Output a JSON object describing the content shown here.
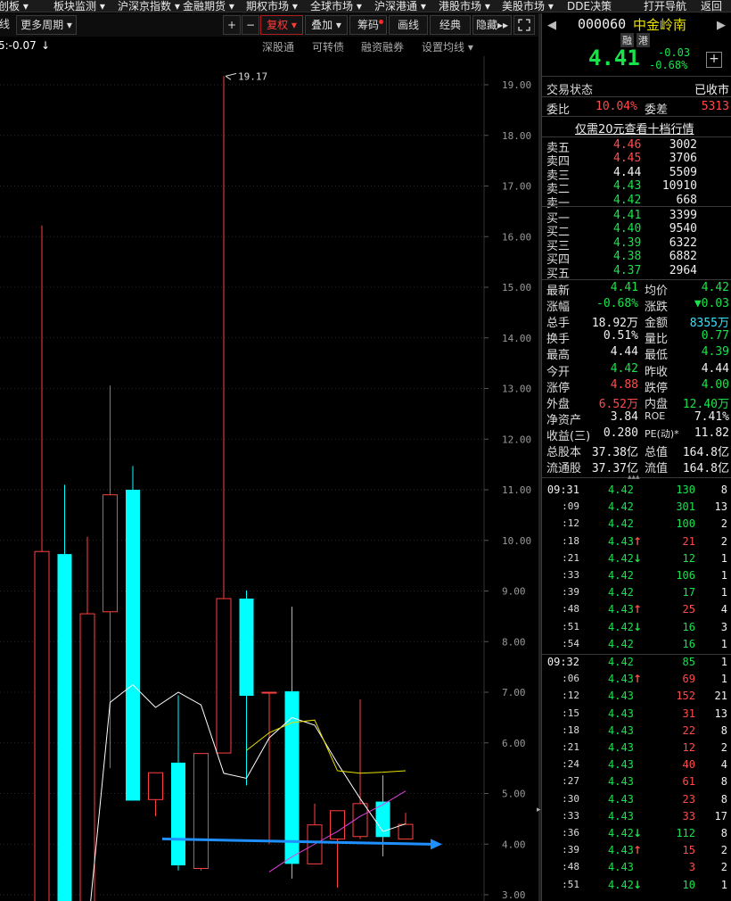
{
  "menu": [
    "创板",
    "板块监测",
    "沪深京指数",
    "金融期货",
    "期权市场",
    "全球市场",
    "沪深港通",
    "港股市场",
    "美股市场",
    "DDE决策",
    "打开导航",
    "返回"
  ],
  "toolbar": {
    "left_label": "线",
    "period": "更多周期",
    "plus": "+",
    "minus": "−",
    "fuquan": "复权",
    "diejia": "叠加",
    "chouma": "筹码",
    "huaxian": "画线",
    "jingdian": "经典",
    "yincang": "隐藏",
    "expand_icon": "expand-icon"
  },
  "subbar": {
    "ma_info": "5:-0.07",
    "arrow": "↓",
    "items": [
      "深股通",
      "可转债",
      "融资融券",
      "设置均线"
    ]
  },
  "chart_data": {
    "type": "candlestick",
    "ylim": [
      3.0,
      20.0
    ],
    "yticks": [
      "19.00",
      "18.00",
      "17.00",
      "16.00",
      "15.00",
      "14.00",
      "13.00",
      "12.00",
      "11.00",
      "10.00",
      "9.00",
      "8.00",
      "7.00",
      "6.00",
      "5.00",
      "4.00",
      "3.00"
    ],
    "annotation_high": "19.17",
    "colors": {
      "up": "#ff4040",
      "down": "#00ffff",
      "ma5": "#ffffff",
      "ma10": "#e8e000",
      "ma20": "#e040e0",
      "arrow": "#1e90ff",
      "grid": "#2a2a2a"
    },
    "candles": [
      {
        "open": 2.0,
        "close": 9.78,
        "high": 16.22,
        "low": 2.0
      },
      {
        "open": 9.73,
        "close": 2.0,
        "high": 11.1,
        "low": 2.0
      },
      {
        "open": 2.0,
        "close": 8.55,
        "high": 10.07,
        "low": 2.0
      },
      {
        "open": 8.59,
        "close": 10.9,
        "high": 13.06,
        "low": 5.5
      },
      {
        "open": 11.0,
        "close": 4.86,
        "high": 11.47,
        "low": 4.86
      },
      {
        "open": 4.88,
        "close": 5.41,
        "high": 5.41,
        "low": 4.55
      },
      {
        "open": 5.61,
        "close": 3.58,
        "high": 6.94,
        "low": 3.48
      },
      {
        "open": 3.52,
        "close": 5.79,
        "high": 5.79,
        "low": 3.48
      },
      {
        "open": 5.8,
        "close": 8.85,
        "high": 19.17,
        "low": 5.8
      },
      {
        "open": 8.85,
        "close": 6.93,
        "high": 9.01,
        "low": 5.16
      },
      {
        "open": 7.0,
        "close": 7.0,
        "high": 7.0,
        "low": 4.0
      },
      {
        "open": 7.02,
        "close": 3.61,
        "high": 8.69,
        "low": 3.32
      },
      {
        "open": 3.61,
        "close": 4.38,
        "high": 4.8,
        "low": 3.61
      },
      {
        "open": 4.1,
        "close": 4.66,
        "high": 4.66,
        "low": 3.14
      },
      {
        "open": 4.15,
        "close": 4.8,
        "high": 6.86,
        "low": 4.1
      },
      {
        "open": 4.84,
        "close": 4.14,
        "high": 5.36,
        "low": 3.76
      },
      {
        "open": 4.1,
        "close": 4.39,
        "high": 4.62,
        "low": 4.1
      }
    ],
    "ma5": [
      null,
      null,
      2.2,
      6.8,
      7.15,
      6.7,
      7.0,
      6.75,
      5.4,
      5.3,
      6.1,
      6.5,
      6.35,
      5.6,
      4.9,
      4.25,
      4.4
    ],
    "ma10": [
      null,
      null,
      null,
      null,
      null,
      null,
      null,
      null,
      null,
      5.85,
      6.2,
      6.4,
      6.45,
      5.45,
      5.4,
      5.42,
      5.45
    ],
    "ma20": [
      null,
      null,
      null,
      null,
      null,
      null,
      null,
      null,
      null,
      null,
      3.45,
      3.75,
      4.0,
      4.25,
      4.55,
      4.78,
      5.05
    ]
  },
  "quote": {
    "code": "000060",
    "name": "中金岭南",
    "tag1": "融",
    "tag2": "港",
    "price": "4.41",
    "change": "-0.03",
    "change_pct": "-0.68%",
    "add_icon": "+",
    "status_label": "交易状态",
    "status_value": "已收市",
    "weibi_label": "委比",
    "weibi_value": "10.04%",
    "weicha_label": "委差",
    "weicha_value": "5313",
    "promo": "仅需20元查看十档行情"
  },
  "asks": [
    {
      "label": "卖五",
      "price": "4.46",
      "vol": "3002",
      "color": "red"
    },
    {
      "label": "卖四",
      "price": "4.45",
      "vol": "3706",
      "color": "red"
    },
    {
      "label": "卖三",
      "price": "4.44",
      "vol": "5509",
      "color": "white"
    },
    {
      "label": "卖二",
      "price": "4.43",
      "vol": "10910",
      "color": "green"
    },
    {
      "label": "卖一",
      "price": "4.42",
      "vol": "668",
      "color": "green"
    }
  ],
  "bids": [
    {
      "label": "买一",
      "price": "4.41",
      "vol": "3399",
      "color": "green"
    },
    {
      "label": "买二",
      "price": "4.40",
      "vol": "9540",
      "color": "green"
    },
    {
      "label": "买三",
      "price": "4.39",
      "vol": "6322",
      "color": "green"
    },
    {
      "label": "买四",
      "price": "4.38",
      "vol": "6882",
      "color": "green"
    },
    {
      "label": "买五",
      "price": "4.37",
      "vol": "2964",
      "color": "green"
    }
  ],
  "stats": [
    [
      {
        "l": "最新",
        "v": "4.41",
        "c": "green"
      },
      {
        "l": "均价",
        "v": "4.42",
        "c": "green"
      }
    ],
    [
      {
        "l": "涨幅",
        "v": "-0.68%",
        "c": "green"
      },
      {
        "l": "涨跌",
        "v": "▼0.03",
        "c": "green"
      }
    ],
    [
      {
        "l": "总手",
        "v": "18.92万",
        "c": "white"
      },
      {
        "l": "金额",
        "v": "8355万",
        "c": "cyan"
      }
    ],
    [
      {
        "l": "换手",
        "v": "0.51%",
        "c": "white"
      },
      {
        "l": "量比",
        "v": "0.77",
        "c": "green"
      }
    ],
    [
      {
        "l": "最高",
        "v": "4.44",
        "c": "white"
      },
      {
        "l": "最低",
        "v": "4.39",
        "c": "green"
      }
    ],
    [
      {
        "l": "今开",
        "v": "4.42",
        "c": "green"
      },
      {
        "l": "昨收",
        "v": "4.44",
        "c": "white"
      }
    ],
    [
      {
        "l": "涨停",
        "v": "4.88",
        "c": "red"
      },
      {
        "l": "跌停",
        "v": "4.00",
        "c": "green"
      }
    ],
    [
      {
        "l": "外盘",
        "v": "6.52万",
        "c": "red"
      },
      {
        "l": "内盘",
        "v": "12.40万",
        "c": "green"
      }
    ],
    [
      {
        "l": "净资产",
        "v": "3.84",
        "c": "white"
      },
      {
        "l": "ROE",
        "v": "7.41%",
        "c": "white"
      }
    ],
    [
      {
        "l": "收益(三)",
        "v": "0.280",
        "c": "white"
      },
      {
        "l": "PE(动)*",
        "v": "11.82",
        "c": "white"
      }
    ],
    [
      {
        "l": "总股本",
        "v": "37.38亿",
        "c": "white"
      },
      {
        "l": "总值",
        "v": "164.8亿",
        "c": "white"
      }
    ],
    [
      {
        "l": "流通股",
        "v": "37.37亿",
        "c": "white"
      },
      {
        "l": "流值",
        "v": "164.8亿",
        "c": "white"
      }
    ]
  ],
  "ticks": [
    {
      "t": "09:31",
      "p": "4.42",
      "a": "",
      "v": "130",
      "n": "8",
      "pc": "green",
      "vc": "green"
    },
    {
      "t": ":09",
      "p": "4.42",
      "a": "",
      "v": "301",
      "n": "13",
      "pc": "green",
      "vc": "green"
    },
    {
      "t": ":12",
      "p": "4.42",
      "a": "",
      "v": "100",
      "n": "2",
      "pc": "green",
      "vc": "green"
    },
    {
      "t": ":18",
      "p": "4.43",
      "a": "↑",
      "v": "21",
      "n": "2",
      "pc": "green",
      "vc": "red"
    },
    {
      "t": ":21",
      "p": "4.42",
      "a": "↓",
      "v": "12",
      "n": "1",
      "pc": "green",
      "vc": "green"
    },
    {
      "t": ":33",
      "p": "4.42",
      "a": "",
      "v": "106",
      "n": "1",
      "pc": "green",
      "vc": "green"
    },
    {
      "t": ":39",
      "p": "4.42",
      "a": "",
      "v": "17",
      "n": "1",
      "pc": "green",
      "vc": "green"
    },
    {
      "t": ":48",
      "p": "4.43",
      "a": "↑",
      "v": "25",
      "n": "4",
      "pc": "green",
      "vc": "red"
    },
    {
      "t": ":51",
      "p": "4.42",
      "a": "↓",
      "v": "16",
      "n": "3",
      "pc": "green",
      "vc": "green"
    },
    {
      "t": ":54",
      "p": "4.42",
      "a": "",
      "v": "16",
      "n": "1",
      "pc": "green",
      "vc": "green"
    },
    {
      "t": "09:32",
      "p": "4.42",
      "a": "",
      "v": "85",
      "n": "1",
      "pc": "green",
      "vc": "green"
    },
    {
      "t": ":06",
      "p": "4.43",
      "a": "↑",
      "v": "69",
      "n": "1",
      "pc": "green",
      "vc": "red"
    },
    {
      "t": ":12",
      "p": "4.43",
      "a": "",
      "v": "152",
      "n": "21",
      "pc": "green",
      "vc": "red"
    },
    {
      "t": ":15",
      "p": "4.43",
      "a": "",
      "v": "31",
      "n": "13",
      "pc": "green",
      "vc": "red"
    },
    {
      "t": ":18",
      "p": "4.43",
      "a": "",
      "v": "22",
      "n": "8",
      "pc": "green",
      "vc": "red"
    },
    {
      "t": ":21",
      "p": "4.43",
      "a": "",
      "v": "12",
      "n": "2",
      "pc": "green",
      "vc": "red"
    },
    {
      "t": ":24",
      "p": "4.43",
      "a": "",
      "v": "40",
      "n": "4",
      "pc": "green",
      "vc": "red"
    },
    {
      "t": ":27",
      "p": "4.43",
      "a": "",
      "v": "61",
      "n": "8",
      "pc": "green",
      "vc": "red"
    },
    {
      "t": ":30",
      "p": "4.43",
      "a": "",
      "v": "23",
      "n": "8",
      "pc": "green",
      "vc": "red"
    },
    {
      "t": ":33",
      "p": "4.43",
      "a": "",
      "v": "33",
      "n": "17",
      "pc": "green",
      "vc": "red"
    },
    {
      "t": ":36",
      "p": "4.42",
      "a": "↓",
      "v": "112",
      "n": "8",
      "pc": "green",
      "vc": "green"
    },
    {
      "t": ":39",
      "p": "4.43",
      "a": "↑",
      "v": "15",
      "n": "2",
      "pc": "green",
      "vc": "red"
    },
    {
      "t": ":48",
      "p": "4.43",
      "a": "",
      "v": "3",
      "n": "2",
      "pc": "green",
      "vc": "red"
    },
    {
      "t": ":51",
      "p": "4.42",
      "a": "↓",
      "v": "10",
      "n": "1",
      "pc": "green",
      "vc": "green"
    }
  ]
}
